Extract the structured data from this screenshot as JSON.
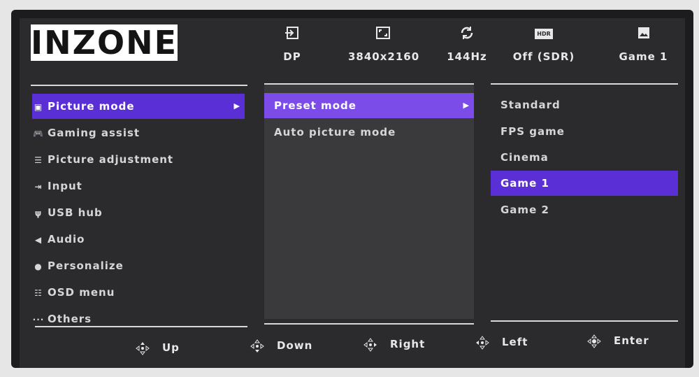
{
  "brand": "INZONE",
  "status": [
    {
      "icon": "input-icon",
      "value": "DP"
    },
    {
      "icon": "resolution-icon",
      "value": "3840x2160"
    },
    {
      "icon": "refresh-rate-icon",
      "value": "144Hz"
    },
    {
      "icon": "hdr-icon",
      "value": "Off (SDR)",
      "icon_text": "HDR"
    },
    {
      "icon": "picture-icon",
      "value": "Game 1"
    }
  ],
  "main_menu": [
    {
      "icon": "picture-icon",
      "glyph": "▣",
      "label": "Picture mode",
      "selected": true
    },
    {
      "icon": "gamepad-icon",
      "glyph": "🎮",
      "label": "Gaming assist"
    },
    {
      "icon": "sliders-icon",
      "glyph": "☰",
      "label": "Picture adjustment"
    },
    {
      "icon": "input-icon",
      "glyph": "⇥",
      "label": "Input"
    },
    {
      "icon": "usb-icon",
      "glyph": "ψ",
      "label": "USB hub"
    },
    {
      "icon": "speaker-icon",
      "glyph": "◀",
      "label": "Audio"
    },
    {
      "icon": "person-icon",
      "glyph": "●",
      "label": "Personalize"
    },
    {
      "icon": "list-icon",
      "glyph": "☷",
      "label": "OSD menu"
    },
    {
      "icon": "more-icon",
      "glyph": "···",
      "label": "Others"
    }
  ],
  "sub_menu": [
    {
      "label": "Preset mode",
      "selected": true
    },
    {
      "label": "Auto picture mode"
    }
  ],
  "options": [
    {
      "label": "Standard"
    },
    {
      "label": "FPS game"
    },
    {
      "label": "Cinema"
    },
    {
      "label": "Game 1",
      "selected": true
    },
    {
      "label": "Game 2"
    }
  ],
  "nav": [
    {
      "icon": "dpad-up-icon",
      "label": "Up"
    },
    {
      "icon": "dpad-down-icon",
      "label": "Down"
    },
    {
      "icon": "dpad-right-icon",
      "label": "Right"
    },
    {
      "icon": "dpad-left-icon",
      "label": "Left"
    },
    {
      "icon": "dpad-center-icon",
      "label": "Enter"
    }
  ],
  "colors": {
    "accent": "#5b2fd6",
    "accent_light": "#7c4ce9",
    "panel": "#2b2b2e"
  }
}
